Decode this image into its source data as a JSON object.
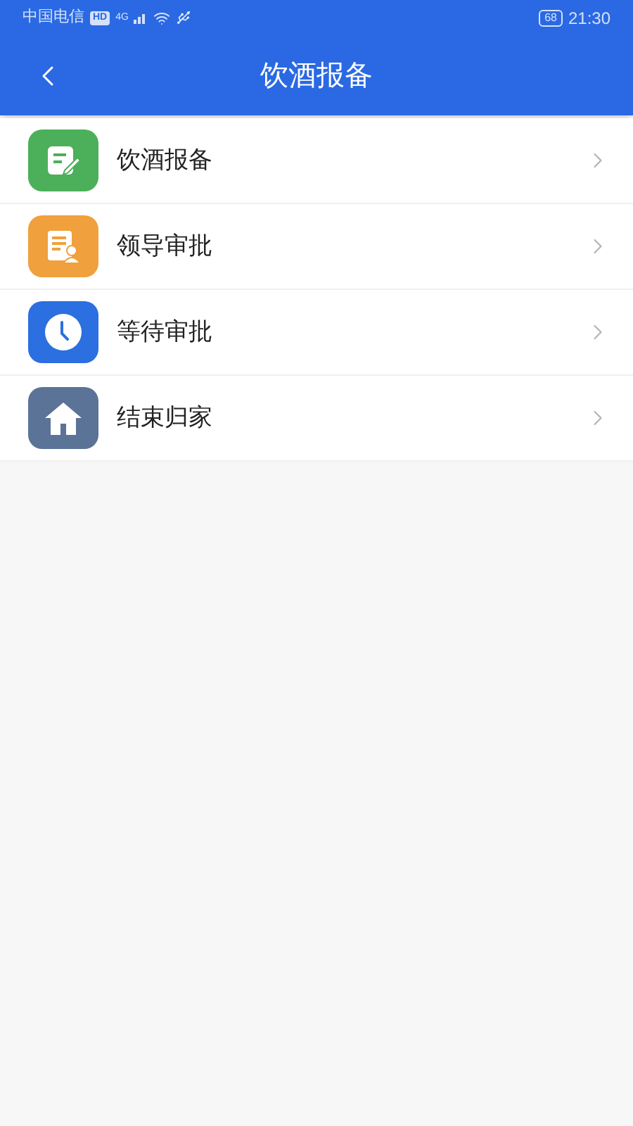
{
  "status_bar": {
    "carrier": "中国电信",
    "hd_badge": "HD",
    "network": "4G",
    "battery": "68",
    "time": "21:30"
  },
  "header": {
    "title": "饮酒报备"
  },
  "menu": [
    {
      "label": "饮酒报备",
      "kind": "report",
      "color": "#4caf5a"
    },
    {
      "label": "领导审批",
      "kind": "approve",
      "color": "#f0a03c"
    },
    {
      "label": "等待审批",
      "kind": "wait",
      "color": "#2b6fe0"
    },
    {
      "label": "结束归家",
      "kind": "home",
      "color": "#5a7396"
    }
  ]
}
